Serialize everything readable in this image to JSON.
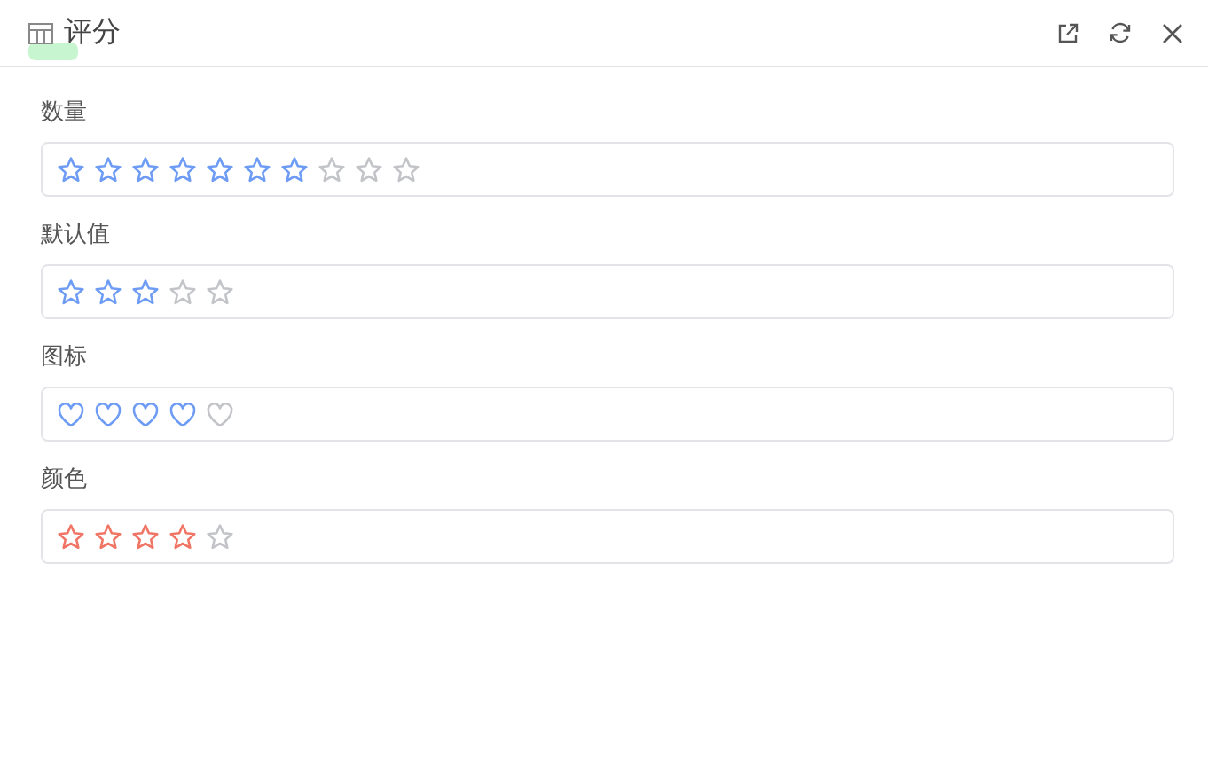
{
  "window": {
    "title": "评分"
  },
  "fields": [
    {
      "label": "数量",
      "kind": "star",
      "color": "#6e9cf5",
      "icons": [
        {
          "filled": true
        },
        {
          "filled": true
        },
        {
          "filled": true
        },
        {
          "filled": true
        },
        {
          "filled": true
        },
        {
          "filled": true
        },
        {
          "filled": true
        },
        {
          "filled": false
        },
        {
          "filled": false
        },
        {
          "filled": false
        }
      ]
    },
    {
      "label": "默认值",
      "kind": "star",
      "color": "#6e9cf5",
      "icons": [
        {
          "filled": true
        },
        {
          "filled": true
        },
        {
          "filled": true
        },
        {
          "filled": false
        },
        {
          "filled": false
        }
      ]
    },
    {
      "label": "图标",
      "kind": "heart",
      "color": "#6e9cf5",
      "icons": [
        {
          "filled": true
        },
        {
          "filled": true
        },
        {
          "filled": true
        },
        {
          "filled": true
        },
        {
          "filled": false
        }
      ]
    },
    {
      "label": "颜色",
      "kind": "star",
      "color": "#f07565",
      "icons": [
        {
          "filled": true
        },
        {
          "filled": true
        },
        {
          "filled": true
        },
        {
          "filled": true
        },
        {
          "filled": false
        }
      ]
    }
  ]
}
